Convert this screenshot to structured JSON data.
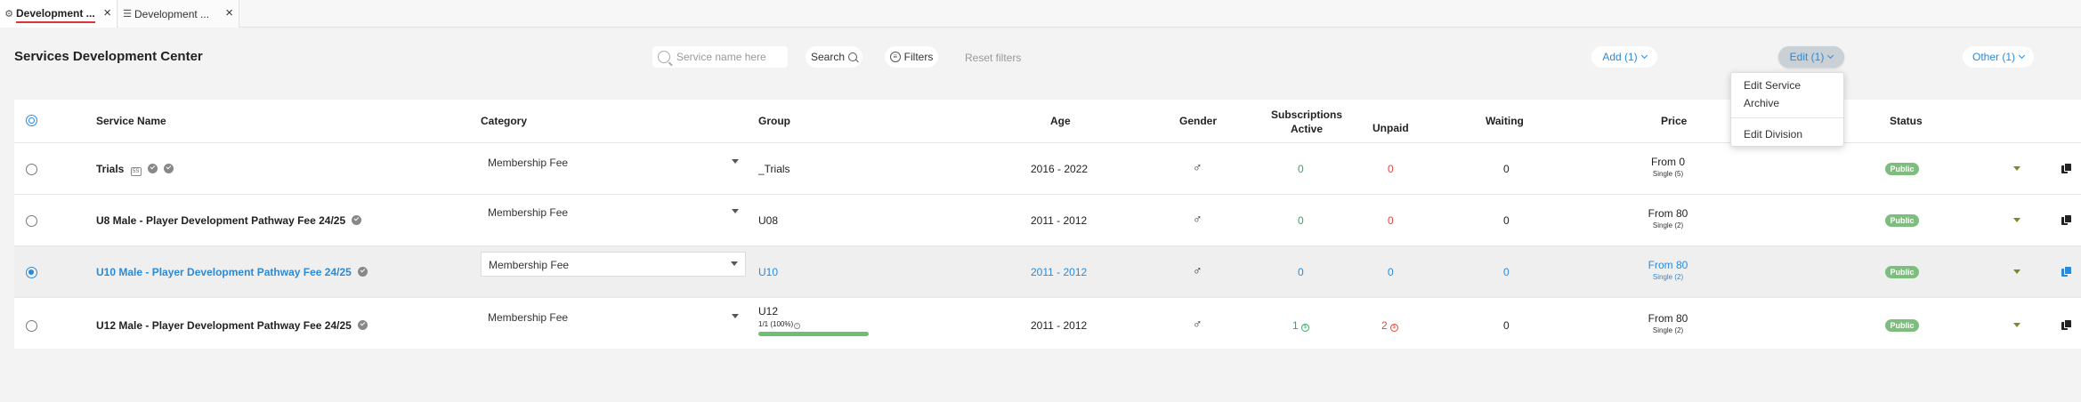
{
  "tabs": [
    {
      "label": "Development ...",
      "icon": "gear-icon",
      "active": true
    },
    {
      "label": "Development ...",
      "icon": "list-icon",
      "active": false
    }
  ],
  "header": {
    "title": "Services Development Center",
    "search_placeholder": "Service name here",
    "search_label": "Search",
    "filters_label": "Filters",
    "reset_label": "Reset filters",
    "add_label": "Add (1)",
    "edit_label": "Edit (1)",
    "other_label": "Other (1)"
  },
  "edit_menu": {
    "items": [
      "Edit Service",
      "Archive",
      "Edit Division"
    ]
  },
  "columns": {
    "service_name": "Service Name",
    "category": "Category",
    "group": "Group",
    "age": "Age",
    "gender": "Gender",
    "subscriptions": "Subscriptions",
    "active": "Active",
    "unpaid": "Unpaid",
    "waiting": "Waiting",
    "price": "Price",
    "status": "Status"
  },
  "rows": [
    {
      "name": "Trials",
      "badge_box": "5S",
      "category": "Membership Fee",
      "group": "_Trials",
      "group_sub": "",
      "age": "2016 - 2022",
      "gender": "♂",
      "active": "0",
      "unpaid": "0",
      "waiting": "0",
      "price": "From 0",
      "price_sub": "Single (5)",
      "status": "Public",
      "selected": false
    },
    {
      "name": "U8 Male - Player Development Pathway Fee 24/25",
      "category": "Membership Fee",
      "group": "U08",
      "group_sub": "",
      "age": "2011 - 2012",
      "gender": "♂",
      "active": "0",
      "unpaid": "0",
      "waiting": "0",
      "price": "From 80",
      "price_sub": "Single (2)",
      "status": "Public",
      "selected": false
    },
    {
      "name": "U10 Male - Player Development Pathway Fee 24/25",
      "category": "Membership Fee",
      "group": "U10",
      "group_sub": "",
      "age": "2011 - 2012",
      "gender": "♂",
      "active": "0",
      "unpaid": "0",
      "waiting": "0",
      "price": "From 80",
      "price_sub": "Single (2)",
      "status": "Public",
      "selected": true
    },
    {
      "name": "U12 Male - Player Development Pathway Fee 24/25",
      "category": "Membership Fee",
      "group": "U12",
      "group_sub": "1/1 (100%)",
      "group_progress": 1.0,
      "age": "2011 - 2012",
      "gender": "♂",
      "active": "1",
      "unpaid": "2",
      "waiting": "0",
      "price": "From 80",
      "price_sub": "Single (2)",
      "status": "Public",
      "selected": false
    }
  ],
  "colors": {
    "accent": "#2b8ad8",
    "active_green": "#35a562",
    "unpaid_red": "#e2463d",
    "status_green": "#7cbf7c"
  }
}
